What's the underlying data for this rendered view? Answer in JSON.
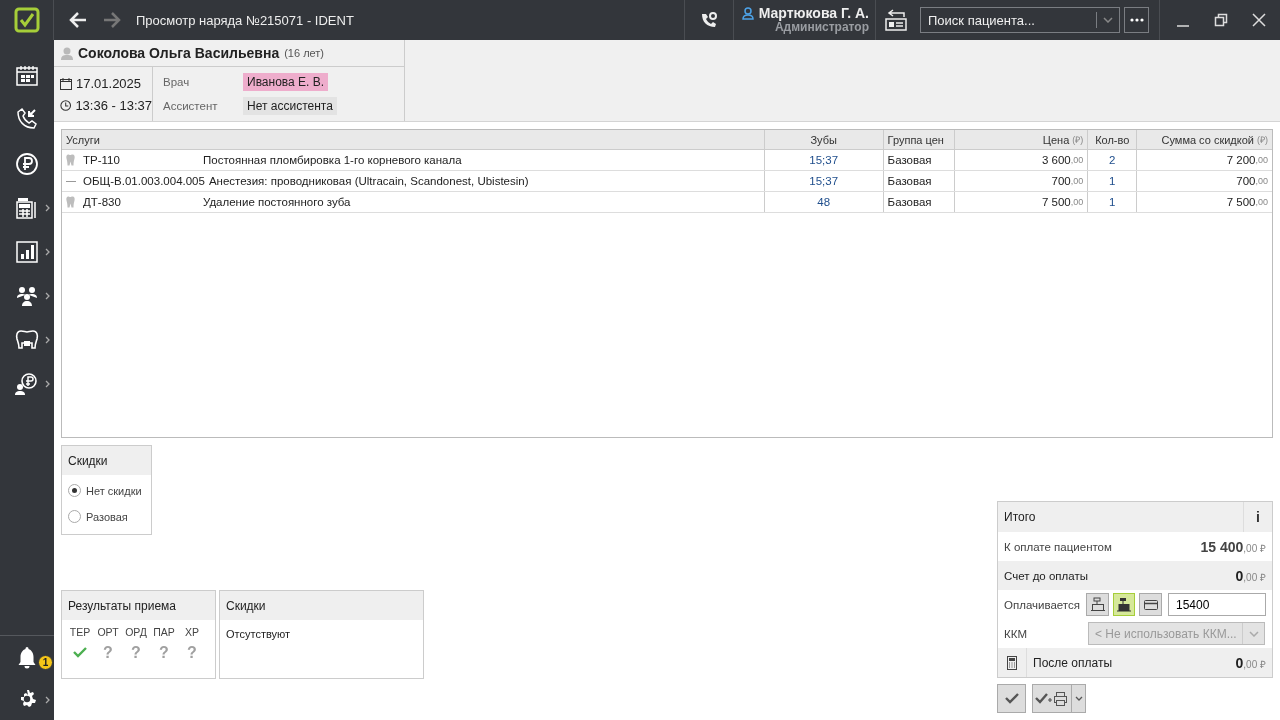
{
  "titlebar": {
    "title": "Просмотр наряда №215071 - IDENT",
    "back_disabled": false,
    "forward_disabled": true,
    "user": {
      "name": "Мартюкова Г. А.",
      "role": "Администратор"
    },
    "search": {
      "placeholder": "Поиск пациента..."
    }
  },
  "sidebar": {
    "items": [
      {
        "kind": "calendar",
        "submenu": false
      },
      {
        "kind": "calls",
        "submenu": false
      },
      {
        "kind": "payments",
        "submenu": false
      },
      {
        "kind": "register",
        "submenu": true
      },
      {
        "kind": "reports",
        "submenu": true
      },
      {
        "kind": "patients",
        "submenu": true
      },
      {
        "kind": "dental",
        "submenu": true
      },
      {
        "kind": "finance",
        "submenu": true
      }
    ],
    "notifications": {
      "count": "1"
    },
    "settings": {
      "submenu": true
    }
  },
  "visit": {
    "patient": "Соколова Ольга Васильевна",
    "age": "(16 лет)",
    "date": "17.01.2025",
    "time": "13:36 - 13:37",
    "staff": [
      {
        "role": "Врач",
        "name": "Иванова Е. В.",
        "color": "#eeadcc"
      },
      {
        "role": "Ассистент",
        "name": "Нет ассистента",
        "color": "#e3e3e3"
      }
    ]
  },
  "table": {
    "columns": [
      {
        "label": "Услуги"
      },
      {
        "label": "Зубы"
      },
      {
        "label": "Группа цен"
      },
      {
        "label": "Цена",
        "unit": "(₽)"
      },
      {
        "label": "Кол-во"
      },
      {
        "label": "Сумма со скидкой",
        "unit": "(₽)"
      }
    ],
    "rows": [
      {
        "kind": "tooth",
        "code": "ТР-110",
        "name": "Постоянная пломбировка 1-го корневого канала",
        "teeth": "15;37",
        "group": "Базовая",
        "price": "3 600",
        "price_cents": ",00",
        "qty": "2",
        "sum": "7 200",
        "sum_cents": ",00"
      },
      {
        "kind": "general",
        "code": "ОБЩ-В.01.003.004.005",
        "name": "Анестезия: проводниковая (Ultracain, Scandonest, Ubistesin)",
        "teeth": "15;37",
        "group": "Базовая",
        "price": "700",
        "price_cents": ",00",
        "qty": "1",
        "sum": "700",
        "sum_cents": ",00"
      },
      {
        "kind": "tooth",
        "code": "ДТ-830",
        "name": "Удаление постоянного зуба",
        "teeth": "48",
        "group": "Базовая",
        "price": "7 500",
        "price_cents": ",00",
        "qty": "1",
        "sum": "7 500",
        "sum_cents": ",00"
      }
    ]
  },
  "discount_choice": {
    "title": "Скидки",
    "options": [
      {
        "label": "Нет скидки",
        "selected": true
      },
      {
        "label": "Разовая",
        "selected": false
      }
    ]
  },
  "results": {
    "title": "Результаты приема",
    "items": [
      {
        "label": "ТЕР",
        "done": true
      },
      {
        "label": "ОРТ",
        "done": false,
        "symbol": "?"
      },
      {
        "label": "ОРД",
        "done": false,
        "symbol": "?"
      },
      {
        "label": "ПАР",
        "done": false,
        "symbol": "?"
      },
      {
        "label": "ХР",
        "done": false,
        "symbol": "?"
      }
    ]
  },
  "discounts": {
    "title": "Скидки",
    "text": "Отсутствуют"
  },
  "totals": {
    "title": "Итого",
    "info": "i",
    "to_pay": {
      "label": "К оплате пациентом",
      "amount": "15 400",
      "cents": ",00 ₽"
    },
    "before": {
      "label": "Счет до оплаты",
      "amount": "0",
      "cents": ",00 ₽"
    },
    "paying": {
      "label": "Оплачивается",
      "methods": [
        {
          "kind": "cash",
          "selected": false
        },
        {
          "kind": "register",
          "selected": true
        },
        {
          "kind": "card",
          "selected": false
        }
      ],
      "value": "15400"
    },
    "kkm": {
      "label": "ККМ",
      "placeholder": "< Не использовать ККМ...",
      "disabled": true
    },
    "after": {
      "label": "После оплаты",
      "amount": "0",
      "cents": ",00 ₽"
    }
  }
}
